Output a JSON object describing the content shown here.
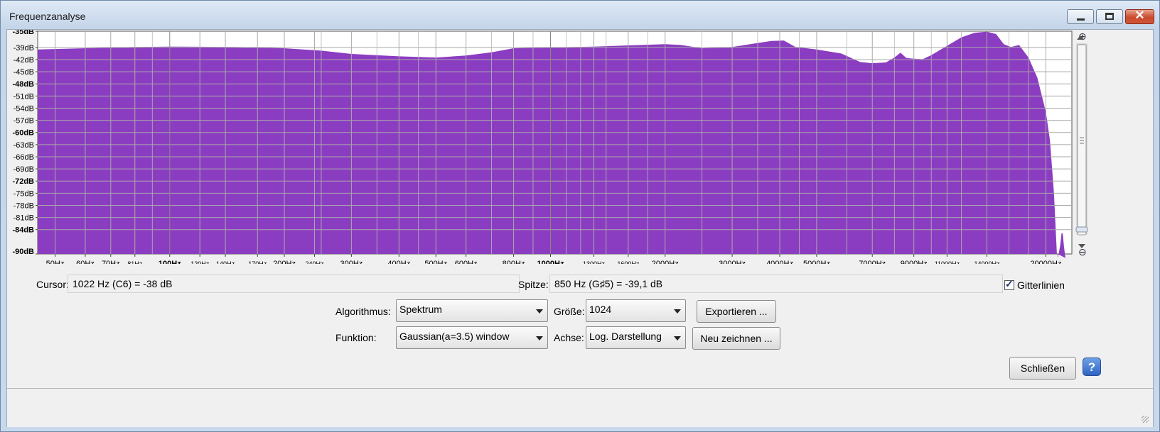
{
  "window": {
    "title": "Frequenzanalyse",
    "close_glyph": "✕"
  },
  "plot": {
    "fill_color": "#8b3dc1",
    "y_ticks": [
      "-35dB",
      "-39dB",
      "-42dB",
      "-45dB",
      "-48dB",
      "-51dB",
      "-54dB",
      "-57dB",
      "-60dB",
      "-63dB",
      "-66dB",
      "-69dB",
      "-72dB",
      "-75dB",
      "-78dB",
      "-81dB",
      "-84dB",
      "-90dB"
    ],
    "y_ticks_bold": [
      "-35dB",
      "-48dB",
      "-60dB",
      "-72dB",
      "-84dB",
      "-90dB"
    ],
    "x_ticks": [
      {
        "label": "50Hz",
        "hz": 50,
        "size": "normal"
      },
      {
        "label": "60Hz",
        "hz": 60,
        "size": "normal"
      },
      {
        "label": "70Hz",
        "hz": 70,
        "size": "normal"
      },
      {
        "label": "81Hz",
        "hz": 81,
        "size": "small"
      },
      {
        "label": "100Hz",
        "hz": 100,
        "size": "bold"
      },
      {
        "label": "120Hz",
        "hz": 120,
        "size": "small"
      },
      {
        "label": "140Hz",
        "hz": 140,
        "size": "small"
      },
      {
        "label": "170Hz",
        "hz": 170,
        "size": "small"
      },
      {
        "label": "200Hz",
        "hz": 200,
        "size": "normal"
      },
      {
        "label": "240Hz",
        "hz": 240,
        "size": "small"
      },
      {
        "label": "300Hz",
        "hz": 300,
        "size": "normal"
      },
      {
        "label": "400Hz",
        "hz": 400,
        "size": "normal"
      },
      {
        "label": "500Hz",
        "hz": 500,
        "size": "normal"
      },
      {
        "label": "600Hz",
        "hz": 600,
        "size": "normal"
      },
      {
        "label": "800Hz",
        "hz": 800,
        "size": "normal"
      },
      {
        "label": "1000Hz",
        "hz": 1000,
        "size": "bold"
      },
      {
        "label": "1300Hz",
        "hz": 1300,
        "size": "small"
      },
      {
        "label": "1600Hz",
        "hz": 1600,
        "size": "small"
      },
      {
        "label": "2000Hz",
        "hz": 2000,
        "size": "normal"
      },
      {
        "label": "3000Hz",
        "hz": 3000,
        "size": "normal"
      },
      {
        "label": "4000Hz",
        "hz": 4000,
        "size": "normal"
      },
      {
        "label": "5000Hz",
        "hz": 5000,
        "size": "normal"
      },
      {
        "label": "7000Hz",
        "hz": 7000,
        "size": "normal"
      },
      {
        "label": "9000Hz",
        "hz": 9000,
        "size": "normal"
      },
      {
        "label": "11000Hz",
        "hz": 11000,
        "size": "small"
      },
      {
        "label": "14000Hz",
        "hz": 14000,
        "size": "small"
      },
      {
        "label": "20000Hz",
        "hz": 20000,
        "size": "normal"
      }
    ],
    "spectrum": [
      [
        45,
        -39.5
      ],
      [
        60,
        -39.2
      ],
      [
        80,
        -38.9
      ],
      [
        100,
        -38.8
      ],
      [
        150,
        -38.9
      ],
      [
        200,
        -39.2
      ],
      [
        250,
        -39.8
      ],
      [
        300,
        -40.6
      ],
      [
        400,
        -41.2
      ],
      [
        500,
        -41.5
      ],
      [
        600,
        -41.0
      ],
      [
        700,
        -40.2
      ],
      [
        800,
        -39.2
      ],
      [
        1000,
        -39.0
      ],
      [
        1300,
        -38.8
      ],
      [
        1600,
        -38.5
      ],
      [
        2000,
        -38.2
      ],
      [
        2200,
        -38.4
      ],
      [
        2500,
        -39.2
      ],
      [
        3000,
        -38.9
      ],
      [
        3500,
        -37.9
      ],
      [
        3800,
        -37.4
      ],
      [
        4100,
        -37.3
      ],
      [
        4400,
        -38.9
      ],
      [
        5000,
        -39.5
      ],
      [
        5800,
        -40.5
      ],
      [
        6500,
        -42.6
      ],
      [
        7000,
        -42.9
      ],
      [
        7600,
        -42.7
      ],
      [
        8000,
        -41.5
      ],
      [
        8300,
        -40.3
      ],
      [
        8600,
        -41.6
      ],
      [
        9000,
        -41.8
      ],
      [
        9500,
        -41.9
      ],
      [
        10000,
        -40.9
      ],
      [
        11000,
        -38.6
      ],
      [
        12000,
        -36.5
      ],
      [
        13000,
        -35.4
      ],
      [
        14000,
        -35.1
      ],
      [
        14800,
        -35.7
      ],
      [
        15500,
        -38.2
      ],
      [
        16200,
        -38.9
      ],
      [
        17000,
        -38.4
      ],
      [
        18000,
        -41.5
      ],
      [
        19000,
        -46.5
      ],
      [
        20000,
        -55.0
      ],
      [
        20500,
        -62.0
      ],
      [
        21000,
        -75.0
      ],
      [
        21400,
        -91.0
      ]
    ],
    "spectrum_tail": [
      [
        21500,
        -91
      ],
      [
        21800,
        -88
      ],
      [
        22000,
        -84.8
      ],
      [
        22150,
        -85
      ],
      [
        22300,
        -88
      ],
      [
        22500,
        -91
      ]
    ]
  },
  "readouts": {
    "cursor_label": "Cursor:",
    "cursor_value": "1022 Hz (C6) = -38 dB",
    "peak_label": "Spitze:",
    "peak_value": "850 Hz (G♯5) = -39,1 dB",
    "gridlines_label": "Gitterlinien",
    "gridlines_checked": "✓"
  },
  "controls": {
    "algorithm_label": "Algorithmus:",
    "algorithm_value": "Spektrum",
    "size_label": "Größe:",
    "size_value": "1024",
    "export_button": "Exportieren ...",
    "function_label": "Funktion:",
    "function_value": "Gaussian(a=3.5) window",
    "axis_label": "Achse:",
    "axis_value": "Log. Darstellung",
    "redraw_button": "Neu zeichnen ...",
    "close_button": "Schließen",
    "help_glyph": "?"
  }
}
